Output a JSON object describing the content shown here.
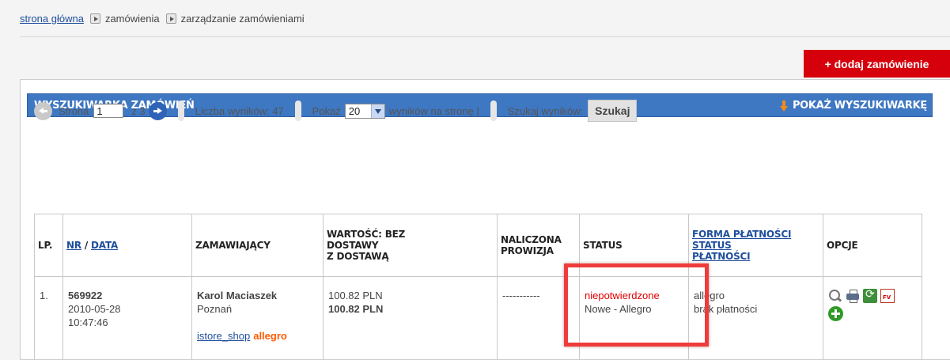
{
  "breadcrumb": {
    "home": "strona główna",
    "orders": "zamówienia",
    "manage": "zarządzanie zamówieniami"
  },
  "add_button": "+ dodaj zamówienie",
  "search_panel": {
    "title": "WYSZUKIWARKA ZAMÓWIEŃ",
    "toggle": "POKAŻ WYSZUKIWARKĘ"
  },
  "pager": {
    "page_label": "Strona",
    "page_value": "1",
    "of_label": "z 3",
    "results_label": "Liczba wyników: 47",
    "show_label": "Pokaż",
    "per_page_value": "20",
    "per_page_suffix": "wyników na stronę |",
    "search_results_label": "Szukaj wyników:",
    "search_button": "Szukaj"
  },
  "table": {
    "headers": {
      "lp": "LP.",
      "nr": "NR",
      "nr_sep": " / ",
      "data": "DATA",
      "customer": "ZAMAWIAJĄCY",
      "value_l1": "WARTOŚĆ: BEZ",
      "value_l2": "DOSTAWY",
      "value_l3": "Z DOSTAWĄ",
      "commission_l1": "NALICZONA",
      "commission_l2": "PROWIZJA",
      "status": "STATUS",
      "payment_l1": "FORMA PŁATNOŚCI",
      "payment_l2": "STATUS",
      "payment_l3": "PŁATNOŚCI",
      "options": "OPCJE"
    },
    "rows": [
      {
        "lp": "1.",
        "nr": "569922",
        "date": "2010-05-28",
        "time": "10:47:46",
        "customer_name": "Karol Maciaszek",
        "customer_city": "Poznań",
        "shop": "istore_shop",
        "shop_platform": "allegro",
        "value_net": "100.82 PLN",
        "value_gross": "100.82 PLN",
        "commission": "-----------",
        "status_main": "niepotwierdzone",
        "status_sub": "Nowe - Allegro",
        "payment_form": "allegro",
        "payment_status": "brak płatności"
      }
    ]
  },
  "icons": [
    "search-icon",
    "print-icon",
    "refresh-icon",
    "invoice-icon",
    "add-icon"
  ],
  "colors": {
    "accent_red": "#d6000d",
    "panel_blue": "#3e77c2",
    "status_red": "#e00000",
    "highlight": "#ee3c3c"
  }
}
